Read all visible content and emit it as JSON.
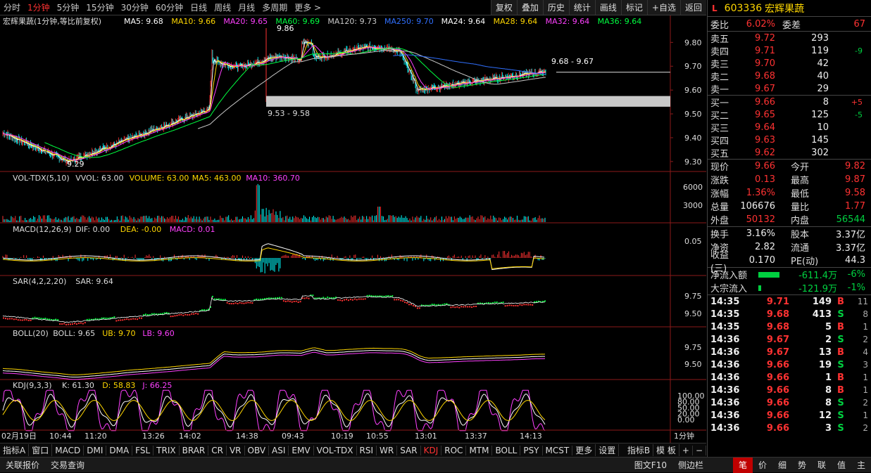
{
  "periods": [
    "分时",
    "1分钟",
    "5分钟",
    "15分钟",
    "30分钟",
    "60分钟",
    "日线",
    "周线",
    "月线",
    "多周期",
    "更多 >"
  ],
  "active_period": "1分钟",
  "tools": [
    "复权",
    "叠加",
    "历史",
    "统计",
    "画线",
    "标记",
    "+自选",
    "返回"
  ],
  "main": {
    "title": "宏辉果蔬(1分钟,等比前复权)",
    "ma": [
      {
        "label": "MA5: 9.68",
        "color": "#ffffff"
      },
      {
        "label": "MA10: 9.66",
        "color": "#ffd700"
      },
      {
        "label": "MA20: 9.65",
        "color": "#ff40ff"
      },
      {
        "label": "MA60: 9.69",
        "color": "#00ff40"
      },
      {
        "label": "MA120: 9.73",
        "color": "#c8c8c8"
      },
      {
        "label": "MA250: 9.70",
        "color": "#3070ff"
      },
      {
        "label": "MA24: 9.64",
        "color": "#ffffff"
      },
      {
        "label": "MA28: 9.64",
        "color": "#ffd700"
      },
      {
        "label": "MA32: 9.64",
        "color": "#ff40ff"
      },
      {
        "label": "MA36: 9.64",
        "color": "#00ff40"
      }
    ],
    "yticks": [
      "9.80",
      "9.70",
      "9.60",
      "9.50",
      "9.40",
      "9.30"
    ],
    "ann": {
      "high": "9.86",
      "low": "9.29",
      "box": "9.53 - 9.58",
      "rng": "9.68 - 9.67"
    }
  },
  "vol": {
    "name": "VOL-TDX(5,10)",
    "vvol": "VVOL: 63.00",
    "volume": "VOLUME: 63.00",
    "ma5": "MA5: 463.00",
    "ma10": "MA10: 360.70",
    "yticks": [
      "6000",
      "3000"
    ]
  },
  "macd": {
    "name": "MACD(12,26,9)",
    "dif": "DIF: 0.00",
    "dea": "DEA: -0.00",
    "macd": "MACD: 0.01",
    "ytick": "0.05"
  },
  "sar": {
    "name": "SAR(4,2,2,20)",
    "val": "SAR: 9.64",
    "yticks": [
      "9.75",
      "9.50"
    ]
  },
  "boll": {
    "name": "BOLL(20)",
    "boll": "BOLL: 9.65",
    "ub": "UB: 9.70",
    "lb": "LB: 9.60",
    "yticks": [
      "9.75",
      "9.50"
    ]
  },
  "kdj": {
    "name": "KDJ(9,3,3)",
    "k": "K: 61.30",
    "d": "D: 58.83",
    "j": "J: 66.25",
    "yticks": [
      "100.00",
      "80.00",
      "50.00",
      "20.00",
      "0.00"
    ]
  },
  "xaxis": [
    "02月19日",
    "10:44",
    "11:20",
    "13:26",
    "14:02",
    "14:38",
    "09:43",
    "10:19",
    "10:55",
    "13:01",
    "13:37",
    "14:13"
  ],
  "period_label": "1分钟",
  "indicator_tabs": [
    "指标A",
    "窗口",
    "MACD",
    "DMI",
    "DMA",
    "FSL",
    "TRIX",
    "BRAR",
    "CR",
    "VR",
    "OBV",
    "ASI",
    "EMV",
    "VOL-TDX",
    "RSI",
    "WR",
    "SAR",
    "KDJ",
    "ROC",
    "MTM",
    "BOLL",
    "PSY",
    "MCST",
    "更多",
    "设置"
  ],
  "active_indicator": "KDJ",
  "bottom_right": [
    "指标B",
    "模 板",
    "+",
    "−"
  ],
  "status": [
    "关联报价",
    "交易查询"
  ],
  "status_right": [
    "图文F10",
    "侧边栏"
  ],
  "right_tabs": [
    "笔",
    "价",
    "细",
    "势",
    "联",
    "值",
    "主"
  ],
  "stock": {
    "flag": "L",
    "code": "603336",
    "name": "宏辉果蔬"
  },
  "weibi": {
    "k": "委比",
    "v": "6.02%",
    "k2": "委差",
    "v2": "67"
  },
  "asks": [
    {
      "label": "卖五",
      "price": "9.72",
      "vol": "293",
      "chg": ""
    },
    {
      "label": "卖四",
      "price": "9.71",
      "vol": "119",
      "chg": "-9"
    },
    {
      "label": "卖三",
      "price": "9.70",
      "vol": "42",
      "chg": ""
    },
    {
      "label": "卖二",
      "price": "9.68",
      "vol": "40",
      "chg": ""
    },
    {
      "label": "卖一",
      "price": "9.67",
      "vol": "29",
      "chg": ""
    }
  ],
  "bids": [
    {
      "label": "买一",
      "price": "9.66",
      "vol": "8",
      "chg": "+5"
    },
    {
      "label": "买二",
      "price": "9.65",
      "vol": "125",
      "chg": "-5"
    },
    {
      "label": "买三",
      "price": "9.64",
      "vol": "10",
      "chg": ""
    },
    {
      "label": "买四",
      "price": "9.63",
      "vol": "145",
      "chg": ""
    },
    {
      "label": "买五",
      "price": "9.62",
      "vol": "302",
      "chg": ""
    }
  ],
  "stats": [
    {
      "k": "现价",
      "v": "9.66",
      "vc": "red",
      "k2": "今开",
      "v2": "9.82",
      "v2c": "red"
    },
    {
      "k": "涨跌",
      "v": "0.13",
      "vc": "red",
      "k2": "最高",
      "v2": "9.87",
      "v2c": "red"
    },
    {
      "k": "涨幅",
      "v": "1.36%",
      "vc": "red",
      "k2": "最低",
      "v2": "9.58",
      "v2c": "red"
    },
    {
      "k": "总量",
      "v": "106676",
      "vc": "white",
      "k2": "量比",
      "v2": "1.77",
      "v2c": "red"
    },
    {
      "k": "外盘",
      "v": "50132",
      "vc": "red",
      "k2": "内盘",
      "v2": "56544",
      "v2c": "green"
    }
  ],
  "stats2": [
    {
      "k": "换手",
      "v": "3.16%",
      "vc": "white",
      "k2": "股本",
      "v2": "3.37亿",
      "v2c": "white"
    },
    {
      "k": "净资",
      "v": "2.82",
      "vc": "white",
      "k2": "流通",
      "v2": "3.37亿",
      "v2c": "white"
    },
    {
      "k": "收益(三)",
      "v": "0.170",
      "vc": "white",
      "k2": "PE(动)",
      "v2": "44.3",
      "v2c": "white"
    }
  ],
  "flows": [
    {
      "k": "净流入额",
      "v": "-611.4万",
      "p": "-6%",
      "bar": 0.6
    },
    {
      "k": "大宗流入",
      "v": "-121.9万",
      "p": "-1%",
      "bar": 0.08
    }
  ],
  "ticks": [
    {
      "t": "14:35",
      "p": "9.71",
      "v": "149",
      "bs": "B",
      "n": "11"
    },
    {
      "t": "14:35",
      "p": "9.68",
      "v": "413",
      "bs": "S",
      "n": "8"
    },
    {
      "t": "14:35",
      "p": "9.68",
      "v": "5",
      "bs": "B",
      "n": "1"
    },
    {
      "t": "14:36",
      "p": "9.67",
      "v": "2",
      "bs": "S",
      "n": "2"
    },
    {
      "t": "14:36",
      "p": "9.67",
      "v": "13",
      "bs": "B",
      "n": "4"
    },
    {
      "t": "14:36",
      "p": "9.66",
      "v": "19",
      "bs": "S",
      "n": "3"
    },
    {
      "t": "14:36",
      "p": "9.66",
      "v": "1",
      "bs": "B",
      "n": "1"
    },
    {
      "t": "14:36",
      "p": "9.66",
      "v": "8",
      "bs": "B",
      "n": "1"
    },
    {
      "t": "14:36",
      "p": "9.66",
      "v": "8",
      "bs": "S",
      "n": "2"
    },
    {
      "t": "14:36",
      "p": "9.66",
      "v": "12",
      "bs": "S",
      "n": "1"
    },
    {
      "t": "14:36",
      "p": "9.66",
      "v": "3",
      "bs": "S",
      "n": "2"
    }
  ]
}
